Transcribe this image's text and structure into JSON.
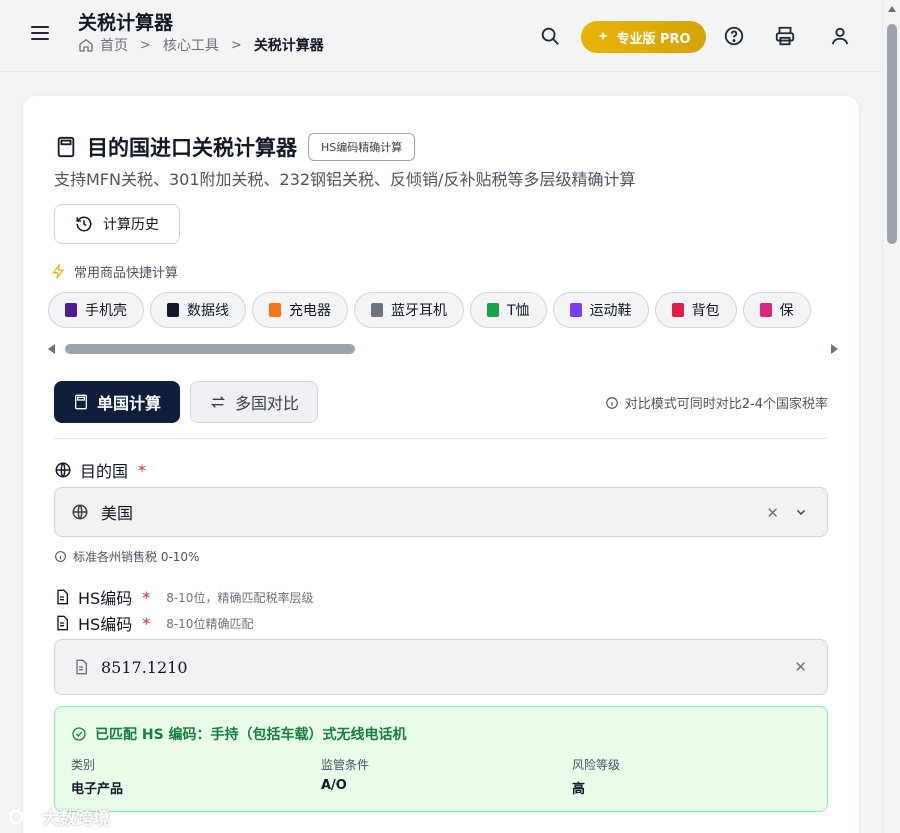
{
  "header": {
    "app_title": "关税计算器",
    "breadcrumb": [
      {
        "label": "首页"
      },
      {
        "label": "核心工具"
      },
      {
        "label": "关税计算器"
      }
    ],
    "pro_label": "专业版 PRO"
  },
  "calculator": {
    "title": "目的国进口关税计算器",
    "hs_tag": "HS编码精确计算",
    "subtitle": "支持MFN关税、301附加关税、232钢铝关税、反倾销/反补贴税等多层级精确计算",
    "history_label": "计算历史",
    "quick_label": "常用商品快捷计算",
    "quick_items": [
      {
        "label": "手机壳",
        "icon": "phone-case-icon",
        "color": "#4c1d95"
      },
      {
        "label": "数据线",
        "icon": "cable-icon",
        "color": "#111827"
      },
      {
        "label": "充电器",
        "icon": "bolt-icon",
        "color": "#f97316"
      },
      {
        "label": "蓝牙耳机",
        "icon": "headphones-icon",
        "color": "#6b7280"
      },
      {
        "label": "T恤",
        "icon": "tshirt-icon",
        "color": "#16a34a"
      },
      {
        "label": "运动鞋",
        "icon": "sneaker-icon",
        "color": "#7c3aed"
      },
      {
        "label": "背包",
        "icon": "backpack-icon",
        "color": "#e11d48"
      },
      {
        "label": "保",
        "icon": "bottle-icon",
        "color": "#db2777"
      }
    ],
    "tabs": {
      "single": "单国计算",
      "multi": "多国对比"
    },
    "compare_hint": "对比模式可同时对比2-4个国家税率"
  },
  "destination": {
    "label": "目的国",
    "required": "*",
    "value": "美国",
    "tax_note": "标准各州销售税 0-10%"
  },
  "hs_code": {
    "label": "HS编码",
    "required": "*",
    "hint1": "8-10位，精确匹配税率层级",
    "hint2": "8-10位精确匹配",
    "value": "8517.1210"
  },
  "match": {
    "title": "已匹配 HS 编码：手持（包括车载）式无线电话机",
    "category_key": "类别",
    "category_val": "电子产品",
    "regulatory_key": "监管条件",
    "regulatory_val": "A/O",
    "risk_key": "风险等级",
    "risk_val": "高"
  },
  "watermark": "大数跨境",
  "colors": {
    "primary_dark": "#0f1e3a",
    "pro_gold": "#eab308",
    "success_green": "#15803d",
    "required_red": "#dc2626"
  }
}
